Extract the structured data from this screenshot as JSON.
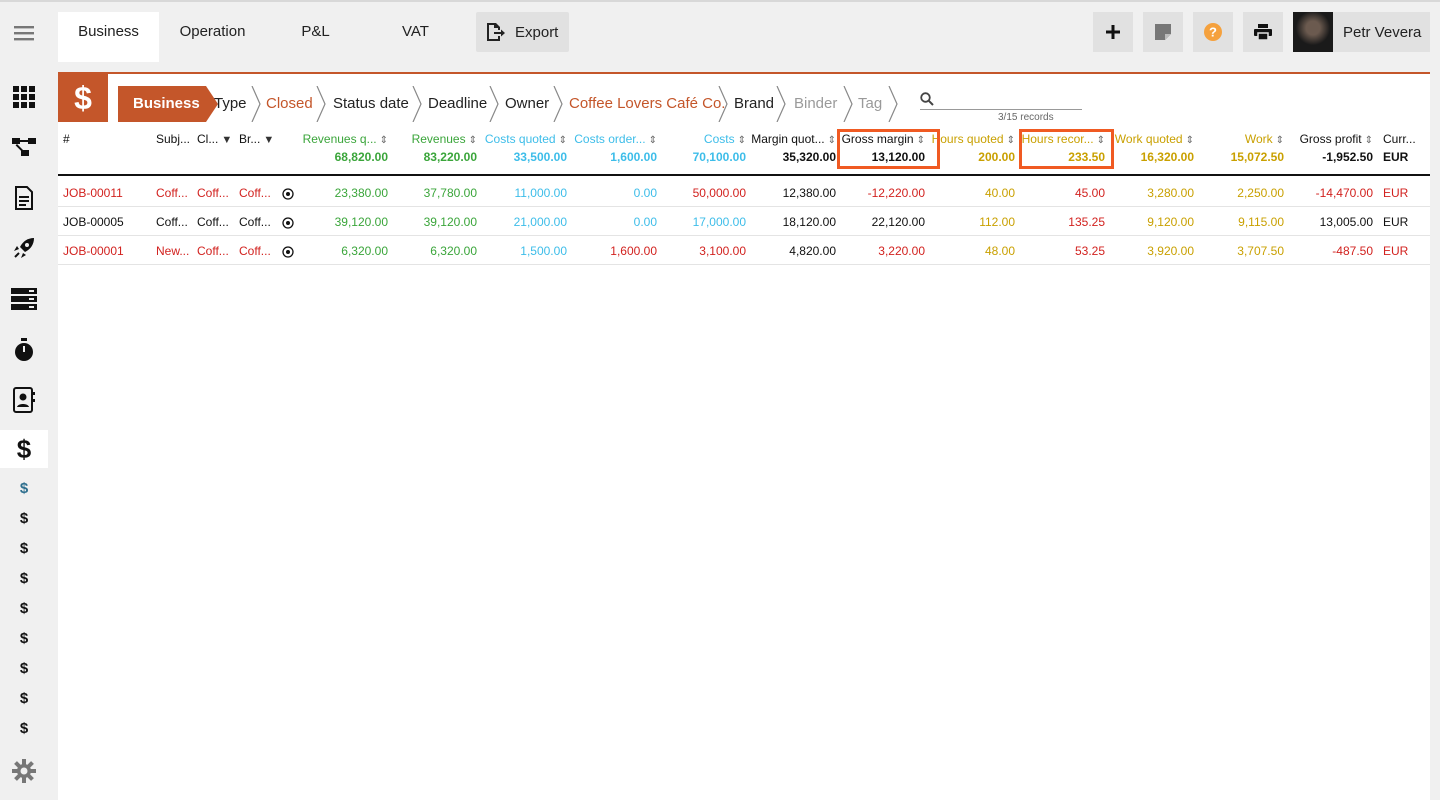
{
  "sidebar": {
    "sub_items": [
      "$",
      "$",
      "$",
      "$",
      "$",
      "$",
      "$",
      "$",
      "$"
    ]
  },
  "topbar": {
    "tabs": [
      "Business",
      "Operation",
      "P&L",
      "VAT"
    ],
    "export_label": "Export",
    "user_name": "Petr Vevera"
  },
  "filters": {
    "module": "Business",
    "items": [
      "Type",
      "Closed",
      "Status date",
      "Deadline",
      "Owner",
      "Coffee Lovers Café Co.",
      "Brand",
      "Binder",
      "Tag"
    ],
    "records": "3/15 records"
  },
  "table": {
    "headers": {
      "num": "#",
      "subject": "Subj...",
      "client": "Cl...",
      "brand": "Br...",
      "revenues_quoted": "Revenues q...",
      "revenues": "Revenues",
      "costs_quoted": "Costs quoted",
      "costs_ordered": "Costs order...",
      "costs": "Costs",
      "margin_quoted": "Margin quot...",
      "gross_margin": "Gross margin",
      "hours_quoted": "Hours quoted",
      "hours_recorded": "Hours recor...",
      "work_quoted": "Work quoted",
      "work": "Work",
      "gross_profit": "Gross profit",
      "currency": "Curr..."
    },
    "totals": {
      "revenues_quoted": "68,820.00",
      "revenues": "83,220.00",
      "costs_quoted": "33,500.00",
      "costs_ordered": "1,600.00",
      "costs": "70,100.00",
      "margin_quoted": "35,320.00",
      "gross_margin": "13,120.00",
      "hours_quoted": "200.00",
      "hours_recorded": "233.50",
      "work_quoted": "16,320.00",
      "work": "15,072.50",
      "gross_profit": "-1,952.50",
      "currency": "EUR"
    },
    "rows": [
      {
        "id": "JOB-00011",
        "subject": "Coff...",
        "client": "Coff...",
        "brand": "Coff...",
        "revenues_quoted": "23,380.00",
        "revenues": "37,780.00",
        "costs_quoted": "11,000.00",
        "costs_ordered": "0.00",
        "costs": "50,000.00",
        "margin_quoted": "12,380.00",
        "gross_margin": "-12,220.00",
        "hours_quoted": "40.00",
        "hours_recorded": "45.00",
        "work_quoted": "3,280.00",
        "work": "2,250.00",
        "gross_profit": "-14,470.00",
        "currency": "EUR"
      },
      {
        "id": "JOB-00005",
        "subject": "Coff...",
        "client": "Coff...",
        "brand": "Coff...",
        "revenues_quoted": "39,120.00",
        "revenues": "39,120.00",
        "costs_quoted": "21,000.00",
        "costs_ordered": "0.00",
        "costs": "17,000.00",
        "margin_quoted": "18,120.00",
        "gross_margin": "22,120.00",
        "hours_quoted": "112.00",
        "hours_recorded": "135.25",
        "work_quoted": "9,120.00",
        "work": "9,115.00",
        "gross_profit": "13,005.00",
        "currency": "EUR"
      },
      {
        "id": "JOB-00001",
        "subject": "New...",
        "client": "Coff...",
        "brand": "Coff...",
        "revenues_quoted": "6,320.00",
        "revenues": "6,320.00",
        "costs_quoted": "1,500.00",
        "costs_ordered": "1,600.00",
        "costs": "3,100.00",
        "margin_quoted": "4,820.00",
        "gross_margin": "3,220.00",
        "hours_quoted": "48.00",
        "hours_recorded": "53.25",
        "work_quoted": "3,920.00",
        "work": "3,707.50",
        "gross_profit": "-487.50",
        "currency": "EUR"
      }
    ]
  },
  "colors": {
    "accent": "#c4562a",
    "highlight": "#f05a22",
    "green": "#3aa53a",
    "blue": "#3dbde9",
    "red": "#d2221f",
    "gold": "#c9a000"
  }
}
